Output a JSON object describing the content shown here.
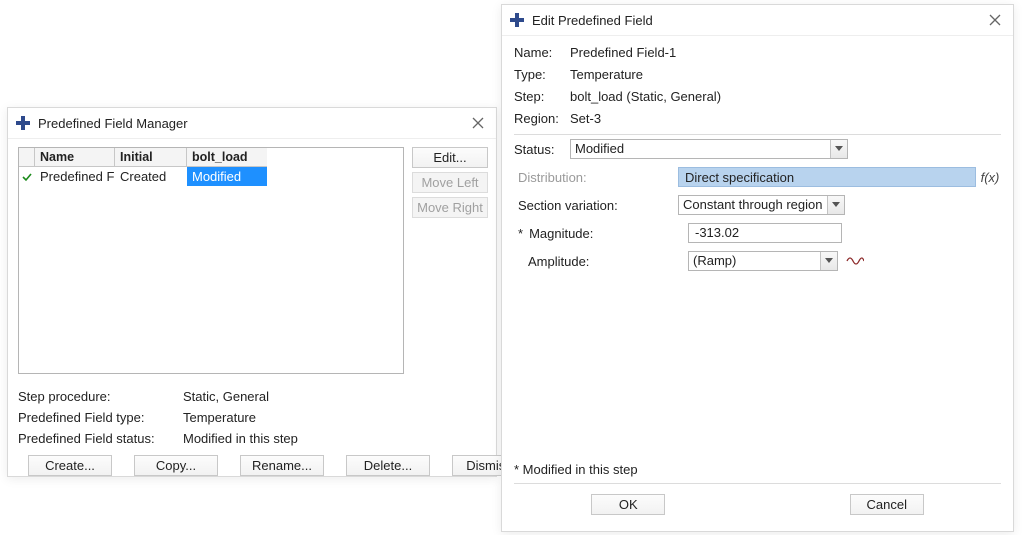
{
  "manager": {
    "title": "Predefined Field Manager",
    "columns": {
      "name": "Name",
      "initial": "Initial",
      "bolt_load": "bolt_load"
    },
    "row": {
      "name": "Predefined Fi",
      "initial": "Created",
      "bolt_load": "Modified"
    },
    "side": {
      "edit": "Edit...",
      "move_left": "Move Left",
      "move_right": "Move Right"
    },
    "info": {
      "step_procedure_label": "Step procedure:",
      "step_procedure_value": "Static, General",
      "type_label": "Predefined Field type:",
      "type_value": "Temperature",
      "status_label": "Predefined Field status:",
      "status_value": "Modified in this step"
    },
    "footer": {
      "create": "Create...",
      "copy": "Copy...",
      "rename": "Rename...",
      "delete": "Delete...",
      "dismiss": "Dismiss"
    }
  },
  "editor": {
    "title": "Edit Predefined Field",
    "name_label": "Name:",
    "name_value": "Predefined Field-1",
    "type_label": "Type:",
    "type_value": "Temperature",
    "step_label": "Step:",
    "step_value": "bolt_load (Static, General)",
    "region_label": "Region:",
    "region_value": "Set-3",
    "status_label": "Status:",
    "status_value": "Modified",
    "distribution_label": "Distribution:",
    "distribution_value": "Direct specification",
    "section_variation_label": "Section variation:",
    "section_variation_value": "Constant through region",
    "magnitude_label": "Magnitude:",
    "magnitude_star": "*",
    "magnitude_value": "-313.02",
    "amplitude_label": "Amplitude:",
    "amplitude_value": "(Ramp)",
    "fx_label": "f(x)",
    "note": "* Modified in this step",
    "ok": "OK",
    "cancel": "Cancel"
  }
}
